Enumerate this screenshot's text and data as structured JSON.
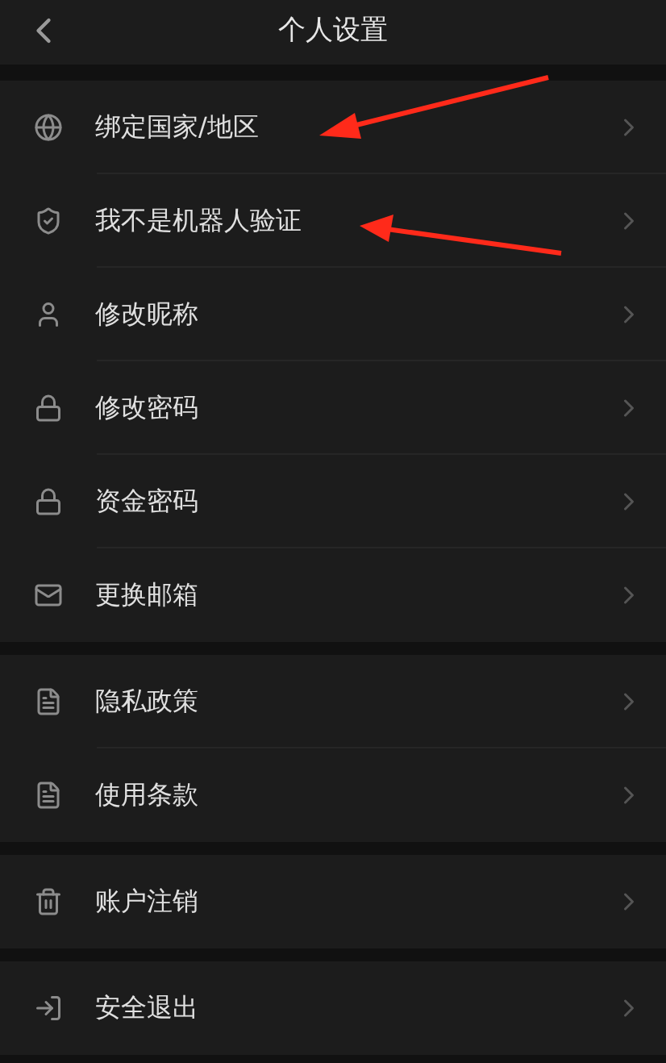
{
  "header": {
    "title": "个人设置"
  },
  "groups": [
    {
      "items": [
        {
          "label": "绑定国家/地区"
        },
        {
          "label": "我不是机器人验证"
        },
        {
          "label": "修改昵称"
        },
        {
          "label": "修改密码"
        },
        {
          "label": "资金密码"
        },
        {
          "label": "更换邮箱"
        }
      ]
    },
    {
      "items": [
        {
          "label": "隐私政策"
        },
        {
          "label": "使用条款"
        }
      ]
    },
    {
      "items": [
        {
          "label": "账户注销"
        }
      ]
    },
    {
      "items": [
        {
          "label": "安全退出"
        }
      ]
    }
  ]
}
